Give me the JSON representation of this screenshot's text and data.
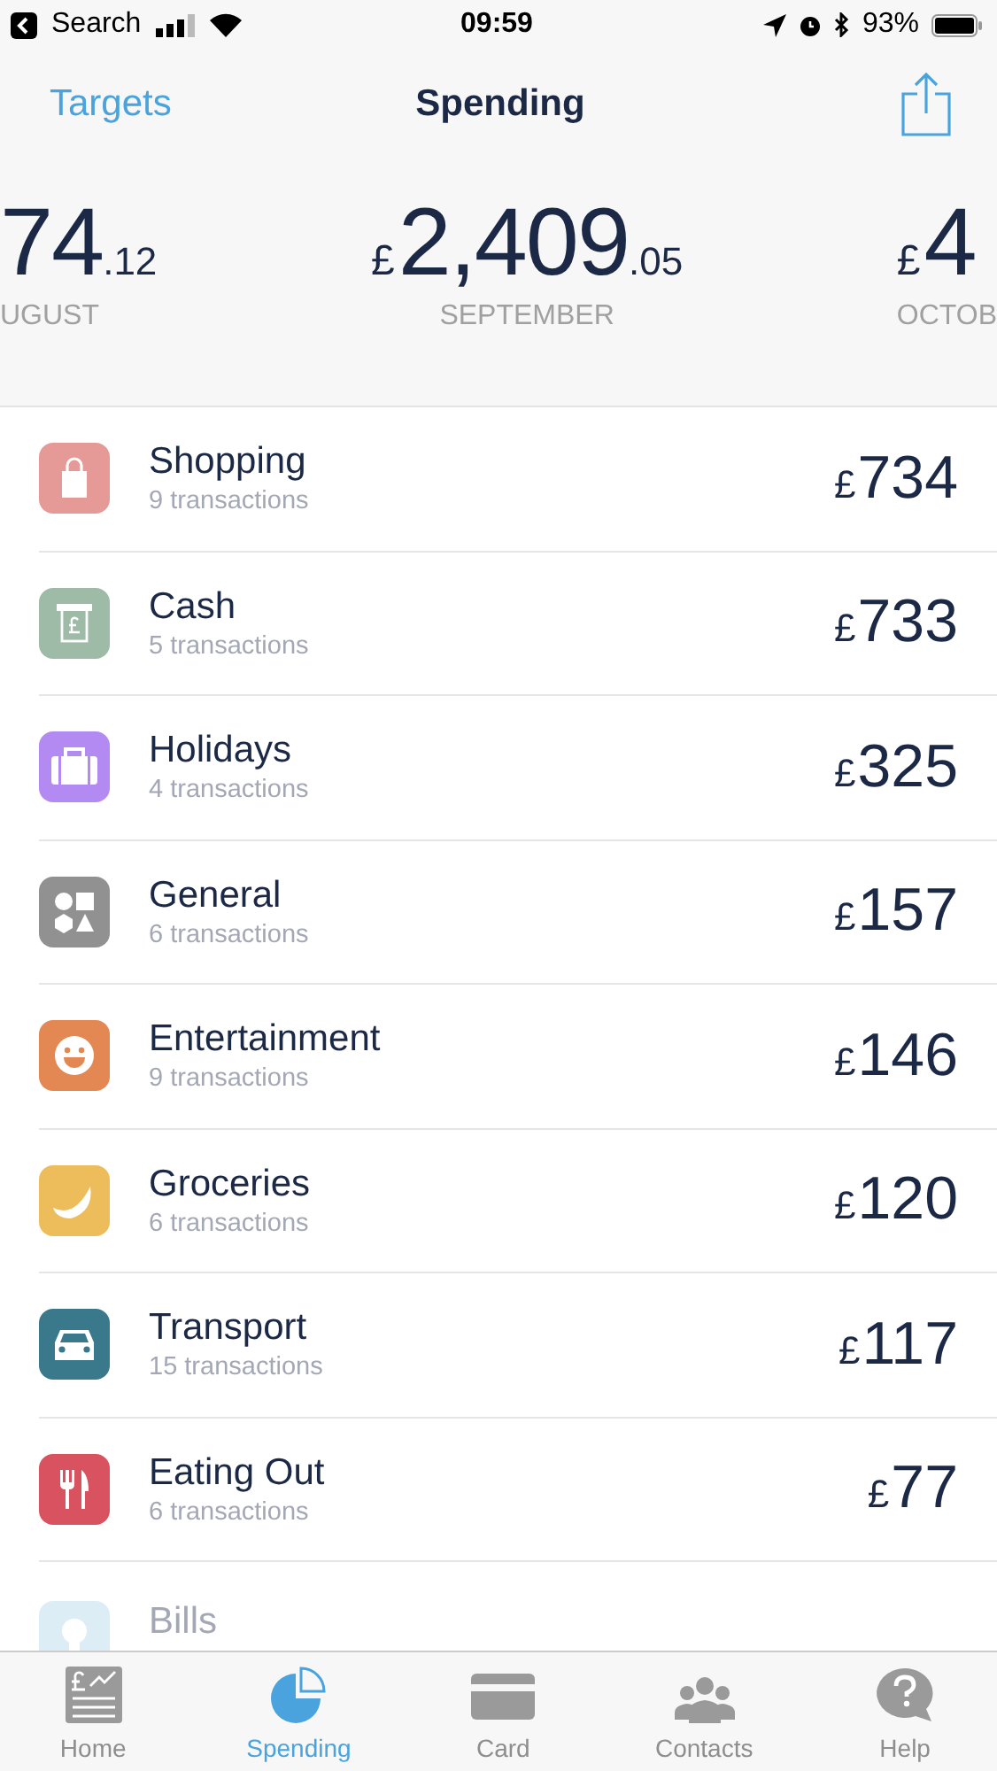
{
  "status_bar": {
    "back_label": "Search",
    "time": "09:59",
    "battery": "93%"
  },
  "nav": {
    "back": "Targets",
    "title": "Spending"
  },
  "months": [
    {
      "kind": "left",
      "amount": "74",
      "cents": ".12",
      "label": "UGUST"
    },
    {
      "kind": "center",
      "currency": "£",
      "amount": "2,409",
      "cents": ".05",
      "label": "SEPTEMBER"
    },
    {
      "kind": "right",
      "currency": "£",
      "amount": "4",
      "label": "OCTOB"
    }
  ],
  "categories": [
    {
      "kind": "shopping",
      "name": "Shopping",
      "count": "9 transactions",
      "currency": "£",
      "amount": "734",
      "color": "#e59a97",
      "disabled": false
    },
    {
      "kind": "cash",
      "name": "Cash",
      "count": "5 transactions",
      "currency": "£",
      "amount": "733",
      "color": "#9dbba6",
      "disabled": false
    },
    {
      "kind": "holidays",
      "name": "Holidays",
      "count": "4 transactions",
      "currency": "£",
      "amount": "325",
      "color": "#b38af2",
      "disabled": false
    },
    {
      "kind": "general",
      "name": "General",
      "count": "6 transactions",
      "currency": "£",
      "amount": "157",
      "color": "#919191",
      "disabled": false
    },
    {
      "kind": "entertainment",
      "name": "Entertainment",
      "count": "9 transactions",
      "currency": "£",
      "amount": "146",
      "color": "#e48853",
      "disabled": false
    },
    {
      "kind": "groceries",
      "name": "Groceries",
      "count": "6 transactions",
      "currency": "£",
      "amount": "120",
      "color": "#edbd5c",
      "disabled": false
    },
    {
      "kind": "transport",
      "name": "Transport",
      "count": "15 transactions",
      "currency": "£",
      "amount": "117",
      "color": "#3a788c",
      "disabled": false
    },
    {
      "kind": "eating",
      "name": "Eating Out",
      "count": "6 transactions",
      "currency": "£",
      "amount": "77",
      "color": "#d9525f",
      "disabled": false
    },
    {
      "kind": "bills",
      "name": "Bills",
      "color": "#dcedf6",
      "disabled": true
    }
  ],
  "tabs": [
    {
      "kind": "home",
      "label": "Home",
      "selected": false
    },
    {
      "kind": "spending",
      "label": "Spending",
      "selected": true
    },
    {
      "kind": "card",
      "label": "Card",
      "selected": false
    },
    {
      "kind": "contacts",
      "label": "Contacts",
      "selected": false
    },
    {
      "kind": "help",
      "label": "Help",
      "selected": false
    }
  ]
}
